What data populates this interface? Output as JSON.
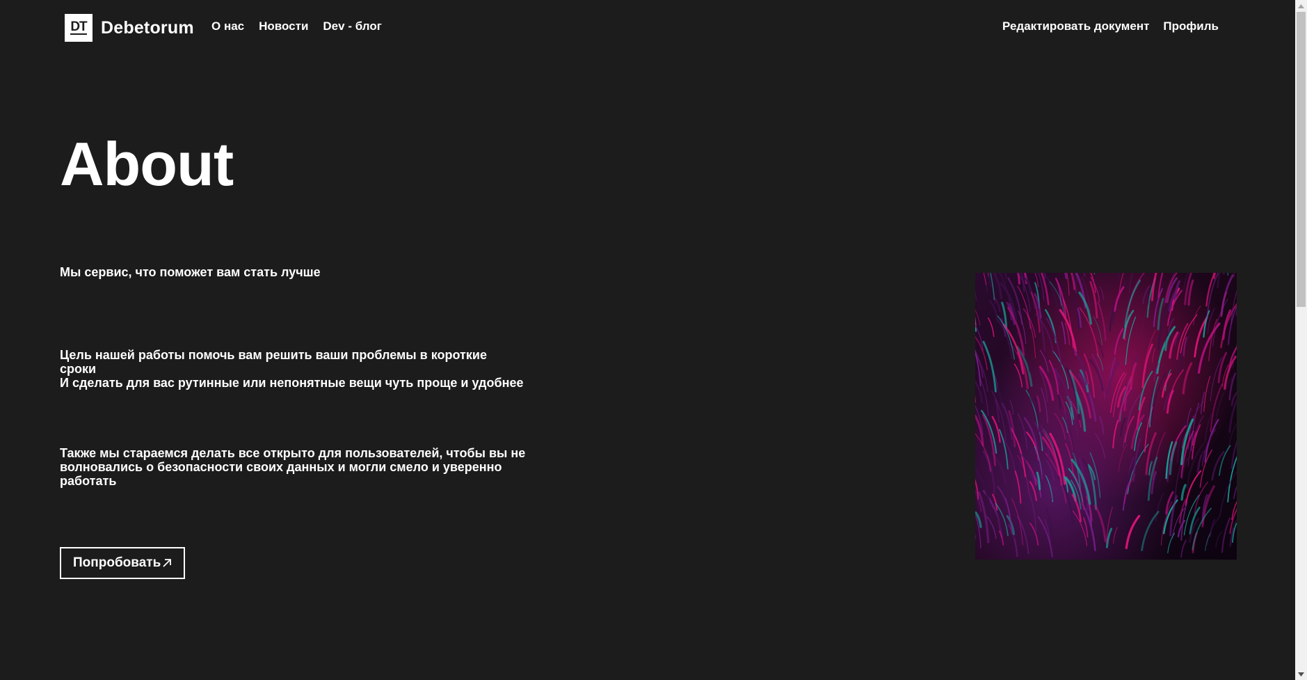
{
  "header": {
    "logo_mark": "DT",
    "logo_text": "Debetorum",
    "nav_left": [
      "О нас",
      "Новости",
      "Dev - блог"
    ],
    "nav_right": [
      "Редактировать документ",
      "Профиль"
    ]
  },
  "main": {
    "title": "About",
    "blocks": [
      [
        "Мы сервис, что поможет вам стать лучше"
      ],
      [
        "Цель нашей работы помочь вам решить ваши проблемы в короткие сроки",
        "И сделать для вас рутинные или непонятные вещи чуть проще и удобнее"
      ],
      [
        "Также мы стараемся делать все открыто для пользователей, чтобы вы не волновались о безопасности своих данных и могли смело и уверенно работать"
      ]
    ],
    "button_label": "Попробовать",
    "button_icon": "arrow-up-right-icon",
    "image": "abstract-fractal-artwork"
  },
  "colors": {
    "background": "#1c1c1c",
    "text": "#ffffff",
    "image_pink": "#e0147a",
    "image_teal": "#1aa39a",
    "image_purple": "#7a1e8c"
  }
}
